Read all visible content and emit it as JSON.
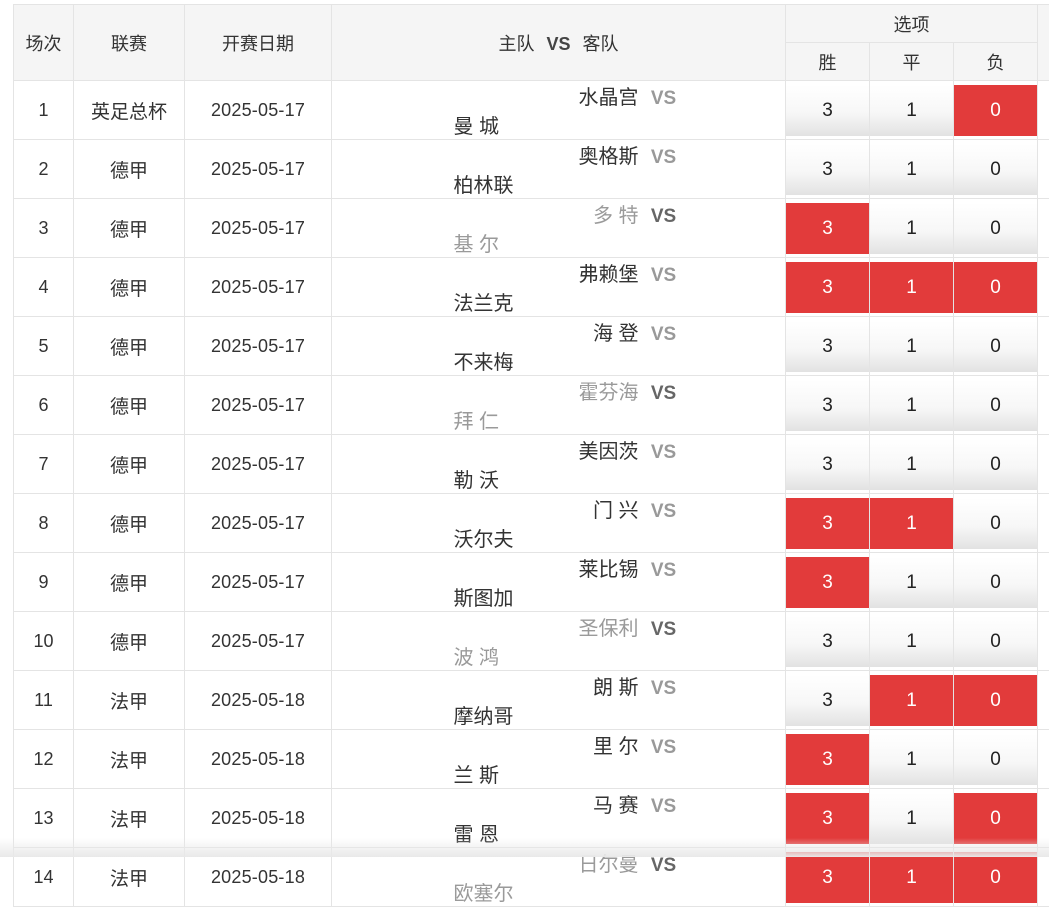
{
  "header": {
    "round": "场次",
    "league": "联赛",
    "date": "开赛日期",
    "home": "主队",
    "vs": "VS",
    "away": "客队",
    "options": "选项",
    "win": "胜",
    "draw": "平",
    "lose": "负"
  },
  "option_values": [
    "3",
    "1",
    "0"
  ],
  "colors": {
    "selected": "#e23b3b",
    "header_bg": "#f5f5f5",
    "border": "#e4e4e4"
  },
  "rows": [
    {
      "no": "1",
      "league": "英足总杯",
      "date": "2025-05-17",
      "home": "水晶宫",
      "vs": "VS",
      "away": "曼 城",
      "dim": false,
      "sel": [
        false,
        false,
        true
      ]
    },
    {
      "no": "2",
      "league": "德甲",
      "date": "2025-05-17",
      "home": "奥格斯",
      "vs": "VS",
      "away": "柏林联",
      "dim": false,
      "sel": [
        false,
        false,
        false
      ]
    },
    {
      "no": "3",
      "league": "德甲",
      "date": "2025-05-17",
      "home": "多 特",
      "vs": "VS",
      "away": "基 尔",
      "dim": true,
      "sel": [
        true,
        false,
        false
      ]
    },
    {
      "no": "4",
      "league": "德甲",
      "date": "2025-05-17",
      "home": "弗赖堡",
      "vs": "VS",
      "away": "法兰克",
      "dim": false,
      "sel": [
        true,
        true,
        true
      ]
    },
    {
      "no": "5",
      "league": "德甲",
      "date": "2025-05-17",
      "home": "海 登",
      "vs": "VS",
      "away": "不来梅",
      "dim": false,
      "sel": [
        false,
        false,
        false
      ]
    },
    {
      "no": "6",
      "league": "德甲",
      "date": "2025-05-17",
      "home": "霍芬海",
      "vs": "VS",
      "away": "拜 仁",
      "dim": true,
      "sel": [
        false,
        false,
        false
      ]
    },
    {
      "no": "7",
      "league": "德甲",
      "date": "2025-05-17",
      "home": "美因茨",
      "vs": "VS",
      "away": "勒 沃",
      "dim": false,
      "sel": [
        false,
        false,
        false
      ]
    },
    {
      "no": "8",
      "league": "德甲",
      "date": "2025-05-17",
      "home": "门 兴",
      "vs": "VS",
      "away": "沃尔夫",
      "dim": false,
      "sel": [
        true,
        true,
        false
      ]
    },
    {
      "no": "9",
      "league": "德甲",
      "date": "2025-05-17",
      "home": "莱比锡",
      "vs": "VS",
      "away": "斯图加",
      "dim": false,
      "sel": [
        true,
        false,
        false
      ]
    },
    {
      "no": "10",
      "league": "德甲",
      "date": "2025-05-17",
      "home": "圣保利",
      "vs": "VS",
      "away": "波 鸿",
      "dim": true,
      "sel": [
        false,
        false,
        false
      ]
    },
    {
      "no": "11",
      "league": "法甲",
      "date": "2025-05-18",
      "home": "朗 斯",
      "vs": "VS",
      "away": "摩纳哥",
      "dim": false,
      "sel": [
        false,
        true,
        true
      ]
    },
    {
      "no": "12",
      "league": "法甲",
      "date": "2025-05-18",
      "home": "里 尔",
      "vs": "VS",
      "away": "兰 斯",
      "dim": false,
      "sel": [
        true,
        false,
        false
      ]
    },
    {
      "no": "13",
      "league": "法甲",
      "date": "2025-05-18",
      "home": "马 赛",
      "vs": "VS",
      "away": "雷 恩",
      "dim": false,
      "sel": [
        true,
        false,
        true
      ]
    },
    {
      "no": "14",
      "league": "法甲",
      "date": "2025-05-18",
      "home": "日尔曼",
      "vs": "VS",
      "away": "欧塞尔",
      "dim": true,
      "sel": [
        true,
        true,
        true
      ]
    }
  ]
}
